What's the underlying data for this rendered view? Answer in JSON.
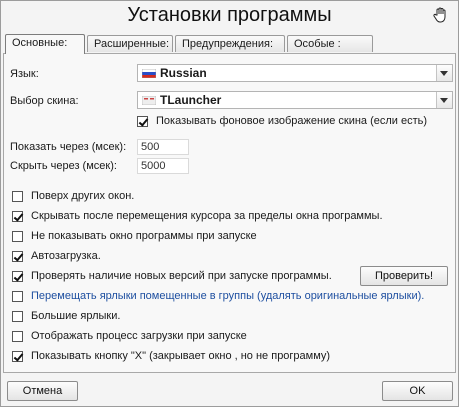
{
  "window": {
    "title": "Установки программы",
    "hand_icon": "hand-icon"
  },
  "tabs": [
    {
      "label": "Основные:",
      "active": true
    },
    {
      "label": "Расширенные:",
      "active": false
    },
    {
      "label": "Предупреждения:",
      "active": false
    },
    {
      "label": "Особые :",
      "active": false
    }
  ],
  "language": {
    "label": "Язык:",
    "value": "Russian",
    "icon": "russia-flag-icon"
  },
  "skin": {
    "label": "Выбор скина:",
    "value": "TLauncher",
    "icon": "skin-thumbnail-icon",
    "show_background": {
      "label": "Показывать фоновое изображение скина (если есть)",
      "checked": true
    }
  },
  "timing": {
    "show_after": {
      "label": "Показать через (мсек):",
      "value": "500"
    },
    "hide_after": {
      "label": "Скрыть через (мсек):",
      "value": "5000"
    }
  },
  "options": [
    {
      "label": "Поверх других окон.",
      "checked": false
    },
    {
      "label": "Скрывать после перемещения курсора за пределы окна программы.",
      "checked": true
    },
    {
      "label": "Не показывать окно программы при запуске",
      "checked": false
    },
    {
      "label": "Автозагрузка.",
      "checked": true
    },
    {
      "label": "Проверять наличие новых версий при запуске программы.",
      "checked": true
    },
    {
      "label": "Перемещать ярлыки помещенные в группы (удалять оригинальные ярлыки).",
      "checked": false
    },
    {
      "label": "Большие ярлыки.",
      "checked": false
    },
    {
      "label": "Отображать процесс загрузки при запуске",
      "checked": false
    },
    {
      "label": "Показывать кнопку \"X\" (закрывает окно , но не программу)",
      "checked": true
    }
  ],
  "check_button": "Проверить!",
  "footer": {
    "cancel": "Отмена",
    "ok": "OK"
  },
  "colors": {
    "link_text": "#1e4fa0"
  }
}
